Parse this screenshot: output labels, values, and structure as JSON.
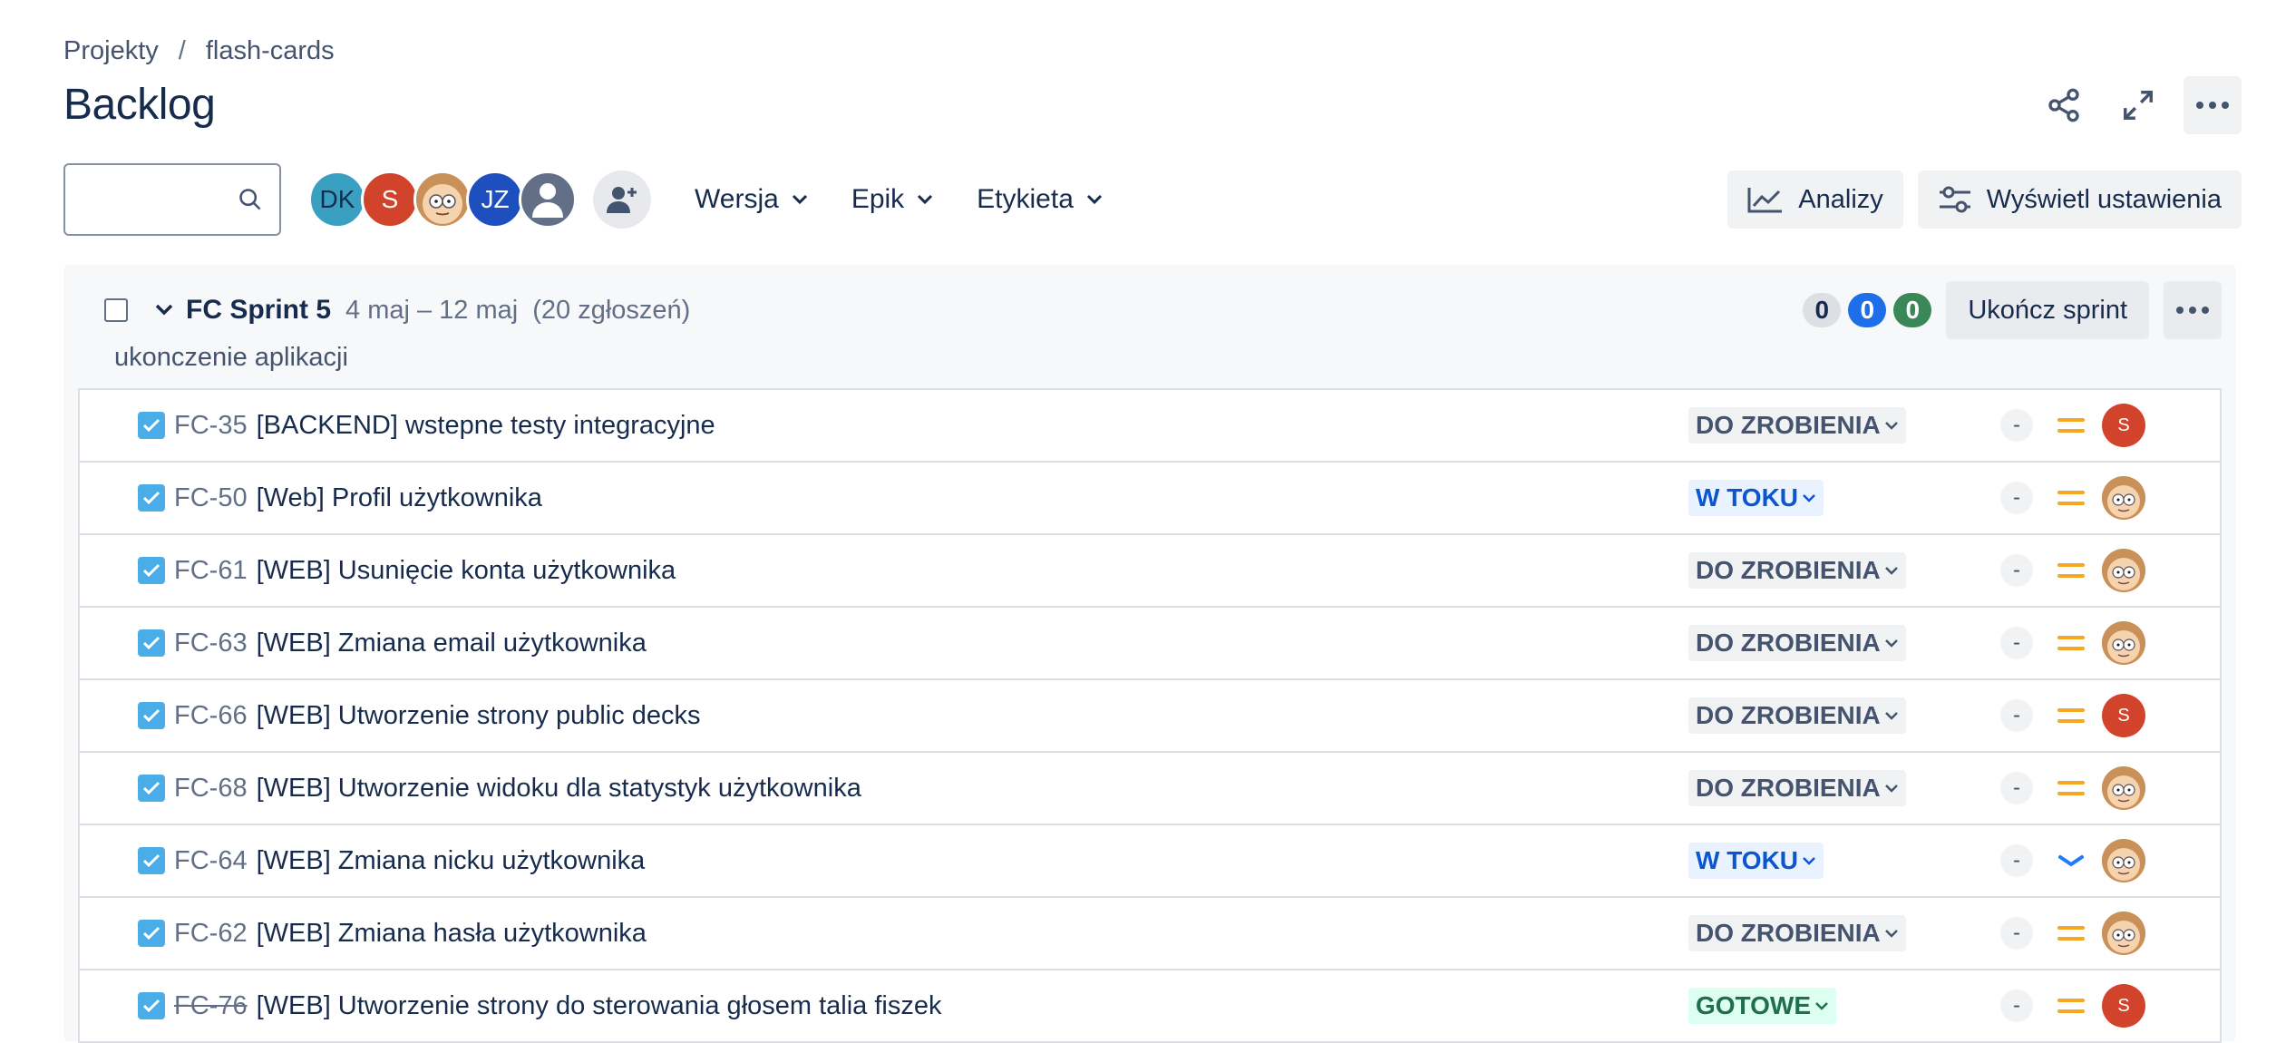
{
  "breadcrumb": {
    "project": "Projekty",
    "separator": "/",
    "current": "flash-cards"
  },
  "page": {
    "title": "Backlog"
  },
  "toolbar": {
    "search_placeholder": "",
    "avatars": [
      {
        "initials": "DK",
        "color": "#3aa0c2"
      },
      {
        "initials": "S",
        "color": "#d1432a"
      },
      {
        "initials": "",
        "icon": "cartoon-avatar-icon"
      },
      {
        "initials": "JZ",
        "color": "#1d4fbe"
      },
      {
        "initials": "",
        "icon": "default-user-icon",
        "color": "#626f86"
      }
    ],
    "filters": {
      "version": "Wersja",
      "epic": "Epik",
      "label": "Etykieta"
    },
    "insights": "Analizy",
    "view_settings": "Wyświetl ustawienia"
  },
  "sprint": {
    "name": "FC Sprint 5",
    "dates": "4 maj – 12 maj",
    "issue_count": "(20 zgłoszeń)",
    "goal": "ukonczenie aplikacji",
    "counts": {
      "todo": "0",
      "in_progress": "0",
      "done": "0"
    },
    "complete_label": "Ukończ sprint",
    "issues": [
      {
        "key": "FC-35",
        "summary": "[BACKEND] wstepne testy integracyjne",
        "status": "DO ZROBIENIA",
        "status_type": "todo",
        "estimate": "-",
        "priority": "medium",
        "assignee": "S"
      },
      {
        "key": "FC-50",
        "summary": "[Web] Profil użytkownika",
        "status": "W TOKU",
        "status_type": "inprogress",
        "estimate": "-",
        "priority": "medium",
        "assignee": ""
      },
      {
        "key": "FC-61",
        "summary": "[WEB] Usunięcie konta użytkownika",
        "status": "DO ZROBIENIA",
        "status_type": "todo",
        "estimate": "-",
        "priority": "medium",
        "assignee": ""
      },
      {
        "key": "FC-63",
        "summary": "[WEB] Zmiana email użytkownika",
        "status": "DO ZROBIENIA",
        "status_type": "todo",
        "estimate": "-",
        "priority": "medium",
        "assignee": ""
      },
      {
        "key": "FC-66",
        "summary": "[WEB] Utworzenie strony public decks",
        "status": "DO ZROBIENIA",
        "status_type": "todo",
        "estimate": "-",
        "priority": "medium",
        "assignee": "S"
      },
      {
        "key": "FC-68",
        "summary": "[WEB] Utworzenie widoku dla statystyk użytkownika",
        "status": "DO ZROBIENIA",
        "status_type": "todo",
        "estimate": "-",
        "priority": "medium",
        "assignee": ""
      },
      {
        "key": "FC-64",
        "summary": "[WEB] Zmiana nicku użytkownika",
        "status": "W TOKU",
        "status_type": "inprogress",
        "estimate": "-",
        "priority": "low",
        "assignee": ""
      },
      {
        "key": "FC-62",
        "summary": "[WEB] Zmiana hasła użytkownika",
        "status": "DO ZROBIENIA",
        "status_type": "todo",
        "estimate": "-",
        "priority": "medium",
        "assignee": ""
      },
      {
        "key": "FC-76",
        "summary": "[WEB] Utworzenie strony do sterowania głosem talia fiszek",
        "status": "GOTOWE",
        "status_type": "done",
        "estimate": "-",
        "priority": "medium",
        "assignee": "S"
      }
    ]
  },
  "colors": {
    "accent": "#0c66e4",
    "priority_medium": "#f5a623",
    "priority_low": "#1d7afc"
  }
}
